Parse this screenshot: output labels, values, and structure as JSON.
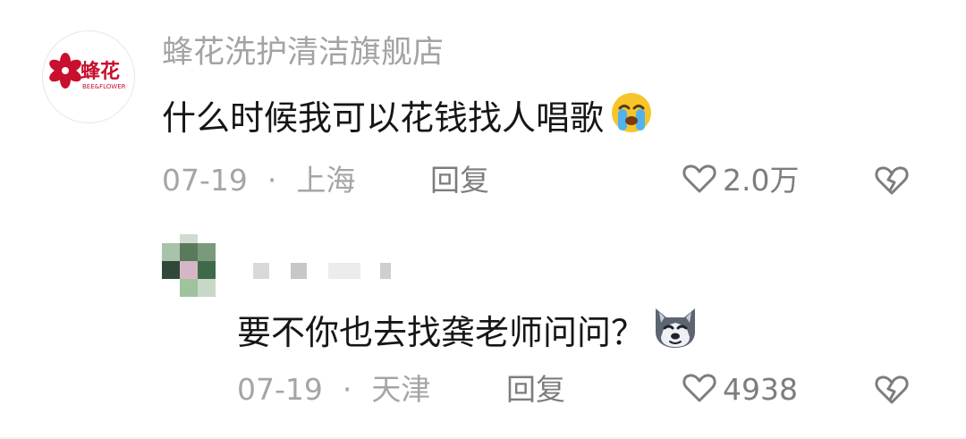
{
  "comments": [
    {
      "user": {
        "name": "蜂花洗护清洁旗舰店",
        "avatar_logo_text": "蜂花",
        "avatar_logo_sub": "BEE&FLOWER",
        "brand_color": "#c8102e"
      },
      "text": "什么时候我可以花钱找人唱歌",
      "emoji": "loudly-crying-face-icon",
      "date": "07-19",
      "separator": "·",
      "location": "上海",
      "reply_label": "回复",
      "likes": "2.0万"
    },
    {
      "user": {
        "name_pixelated": true,
        "avatar_pixelated": true
      },
      "text": "要不你也去找龚老师问问？",
      "emoji": "husky-dog-face-icon",
      "date": "07-19",
      "separator": "·",
      "location": "天津",
      "reply_label": "回复",
      "likes": "4938"
    }
  ],
  "colors": {
    "text_primary": "#161616",
    "text_secondary": "#a5a5a5",
    "action_gray": "#7d7d7d"
  }
}
